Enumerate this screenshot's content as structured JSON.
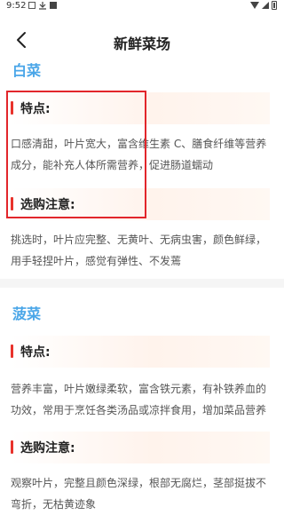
{
  "status_bar": {
    "time": "9:52"
  },
  "header": {
    "title": "新鲜菜场"
  },
  "sections": [
    {
      "name": "白菜",
      "features_label": "特点:",
      "features_text": "口感清甜，叶片宽大，富含维生素 C、膳食纤维等营养成分，能补充人体所需营养，促进肠道蠕动",
      "tips_label": "选购注意:",
      "tips_text": "挑选时，叶片应完整、无黄叶、无病虫害，颜色鲜绿，用手轻捏叶片，感觉有弹性、不发蔫"
    },
    {
      "name": "菠菜",
      "features_label": "特点:",
      "features_text": "营养丰富，叶片嫩绿柔软，富含铁元素，有补铁养血的功效，常用于烹饪各类汤品或凉拌食用，增加菜品营养",
      "tips_label": "选购注意:",
      "tips_text": "观察叶片，完整且颜色深绿，根部无腐烂，茎部挺拔不弯折，无枯黄迹象"
    }
  ]
}
